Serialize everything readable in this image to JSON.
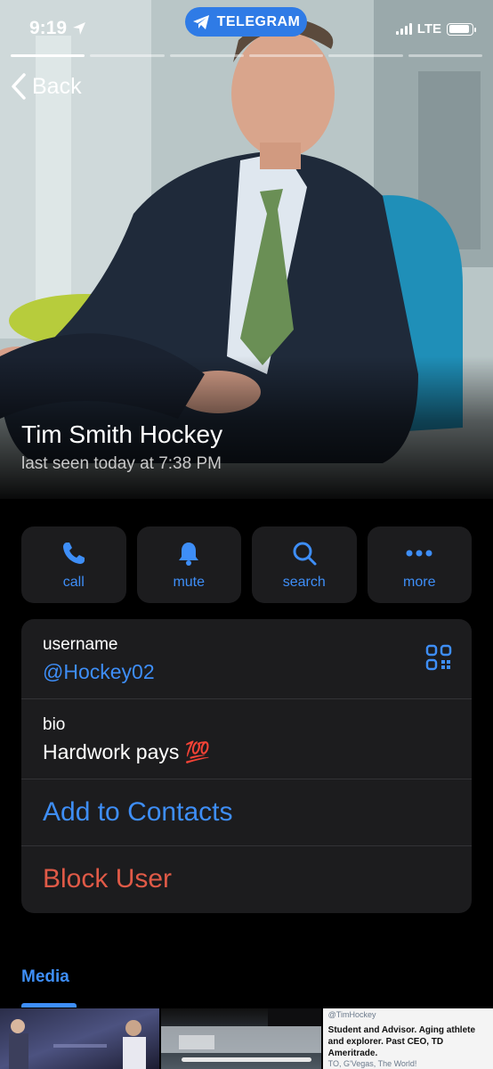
{
  "status_bar": {
    "time": "9:19",
    "app_pill": "TELEGRAM",
    "network": "LTE",
    "battery_level": 0.9
  },
  "nav": {
    "back_label": "Back"
  },
  "profile": {
    "name": "Tim Smith Hockey",
    "last_seen": "last seen today at 7:38 PM"
  },
  "actions": [
    {
      "label": "call",
      "icon": "phone-icon"
    },
    {
      "label": "mute",
      "icon": "bell-icon"
    },
    {
      "label": "search",
      "icon": "search-icon"
    },
    {
      "label": "more",
      "icon": "ellipsis-icon"
    }
  ],
  "info": {
    "username_label": "username",
    "username_value": "@Hockey02",
    "bio_label": "bio",
    "bio_value": "Hardwork pays 💯",
    "add_contact": "Add to Contacts",
    "block_user": "Block User"
  },
  "media": {
    "tab_label": "Media",
    "thumb3_handle": "@TimHockey",
    "thumb3_bio": "Student and Advisor. Aging athlete and explorer. Past CEO, TD Ameritrade.",
    "thumb3_location": "TO, G'Vegas, The World!"
  },
  "colors": {
    "accent": "#3e8ef7",
    "danger": "#e05a47",
    "card": "#1c1c1e",
    "pill": "#2f7be6"
  }
}
